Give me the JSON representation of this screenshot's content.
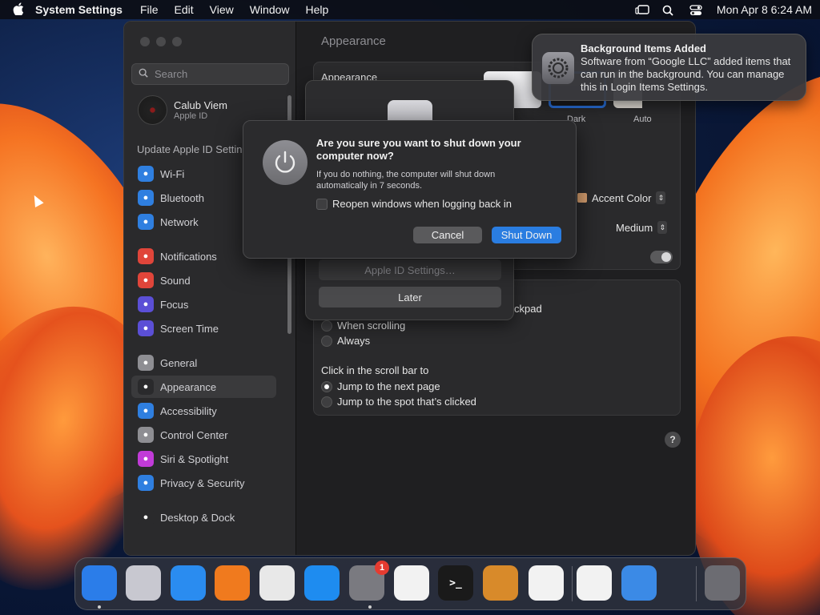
{
  "menubar": {
    "app_name": "System Settings",
    "menus": [
      "File",
      "Edit",
      "View",
      "Window",
      "Help"
    ],
    "clock": "Mon Apr 8  6:24 AM",
    "icons": [
      "stage-manager-icon",
      "search-icon",
      "control-center-icon"
    ]
  },
  "settings": {
    "search_placeholder": "Search",
    "user": {
      "name": "Calub Viem",
      "sub": "Apple ID"
    },
    "update_text": "Update Apple ID Settings",
    "sidebar": [
      {
        "label": "Wi-Fi",
        "icon": "wifi-icon",
        "color": "#2f7fe0"
      },
      {
        "label": "Bluetooth",
        "icon": "bluetooth-icon",
        "color": "#2f7fe0"
      },
      {
        "label": "Network",
        "icon": "network-icon",
        "color": "#2f7fe0"
      },
      {
        "label": "Notifications",
        "icon": "bell-icon",
        "color": "#e0453a"
      },
      {
        "label": "Sound",
        "icon": "speaker-icon",
        "color": "#e0453a"
      },
      {
        "label": "Focus",
        "icon": "moon-icon",
        "color": "#5b4fd6"
      },
      {
        "label": "Screen Time",
        "icon": "hourglass-icon",
        "color": "#5b4fd6"
      },
      {
        "label": "General",
        "icon": "gear-icon",
        "color": "#8e8e93"
      },
      {
        "label": "Appearance",
        "icon": "appearance-icon",
        "color": "#2a2a2c"
      },
      {
        "label": "Accessibility",
        "icon": "accessibility-icon",
        "color": "#2f7fe0"
      },
      {
        "label": "Control Center",
        "icon": "control-center-icon",
        "color": "#8e8e93"
      },
      {
        "label": "Siri & Spotlight",
        "icon": "siri-icon",
        "color": "#c13bd8"
      },
      {
        "label": "Privacy & Security",
        "icon": "hand-icon",
        "color": "#2f7fe0"
      },
      {
        "label": "Desktop & Dock",
        "icon": "dock-icon",
        "color": "#2a2a2c"
      }
    ],
    "main": {
      "title": "Appearance",
      "appearance_label": "Appearance",
      "themes": [
        "Dark",
        "Auto"
      ],
      "accent_label": "Accent Color",
      "size_value": "Medium",
      "swatch_colors": [
        "#e0453a",
        "#f08a24",
        "#f4c82a",
        "#5fbf4a",
        "#8e8e93"
      ],
      "trackpad_text": "ckpad",
      "scroll_options": [
        "When scrolling",
        "Always"
      ],
      "click_label": "Click in the scroll bar to",
      "click_options": [
        "Jump to the next page",
        "Jump to the spot that’s clicked"
      ]
    }
  },
  "sheet": {
    "btn_settings": "Apple ID Settings…",
    "btn_later": "Later"
  },
  "dialog": {
    "title": "Are you sure you want to shut down your computer now?",
    "message": "If you do nothing, the computer will shut down automatically in 7 seconds.",
    "checkbox_label": "Reopen windows when logging back in",
    "cancel": "Cancel",
    "confirm": "Shut Down"
  },
  "notification": {
    "title": "Background Items Added",
    "body": "Software from “Google LLC” added items that can run in the background. You can manage this in Login Items Settings."
  },
  "dock": {
    "apps": [
      {
        "name": "finder-icon",
        "color": "#2b7de9"
      },
      {
        "name": "launchpad-icon",
        "color": "#c8c8d0"
      },
      {
        "name": "safari-icon",
        "color": "#2a8cf0"
      },
      {
        "name": "firefox-icon",
        "color": "#f07a1e"
      },
      {
        "name": "chrome-icon",
        "color": "#e8e8e8"
      },
      {
        "name": "app-store-icon",
        "color": "#1e8cf0"
      },
      {
        "name": "system-settings-icon",
        "color": "#7a7a80"
      },
      {
        "name": "textedit-icon",
        "color": "#f2f2f2"
      },
      {
        "name": "terminal-icon",
        "color": "#1a1a1a"
      },
      {
        "name": "garageband-icon",
        "color": "#d88a2a"
      },
      {
        "name": "vscode-icon",
        "color": "#f2f2f2"
      },
      {
        "name": "visual-studio-icon",
        "color": "#f2f2f2"
      },
      {
        "name": "weather-icon",
        "color": "#3b8ae6"
      },
      {
        "name": "trash-icon",
        "color": "#6c6c72"
      }
    ],
    "settings_badge": "1",
    "terminal_prompt": ">_"
  }
}
